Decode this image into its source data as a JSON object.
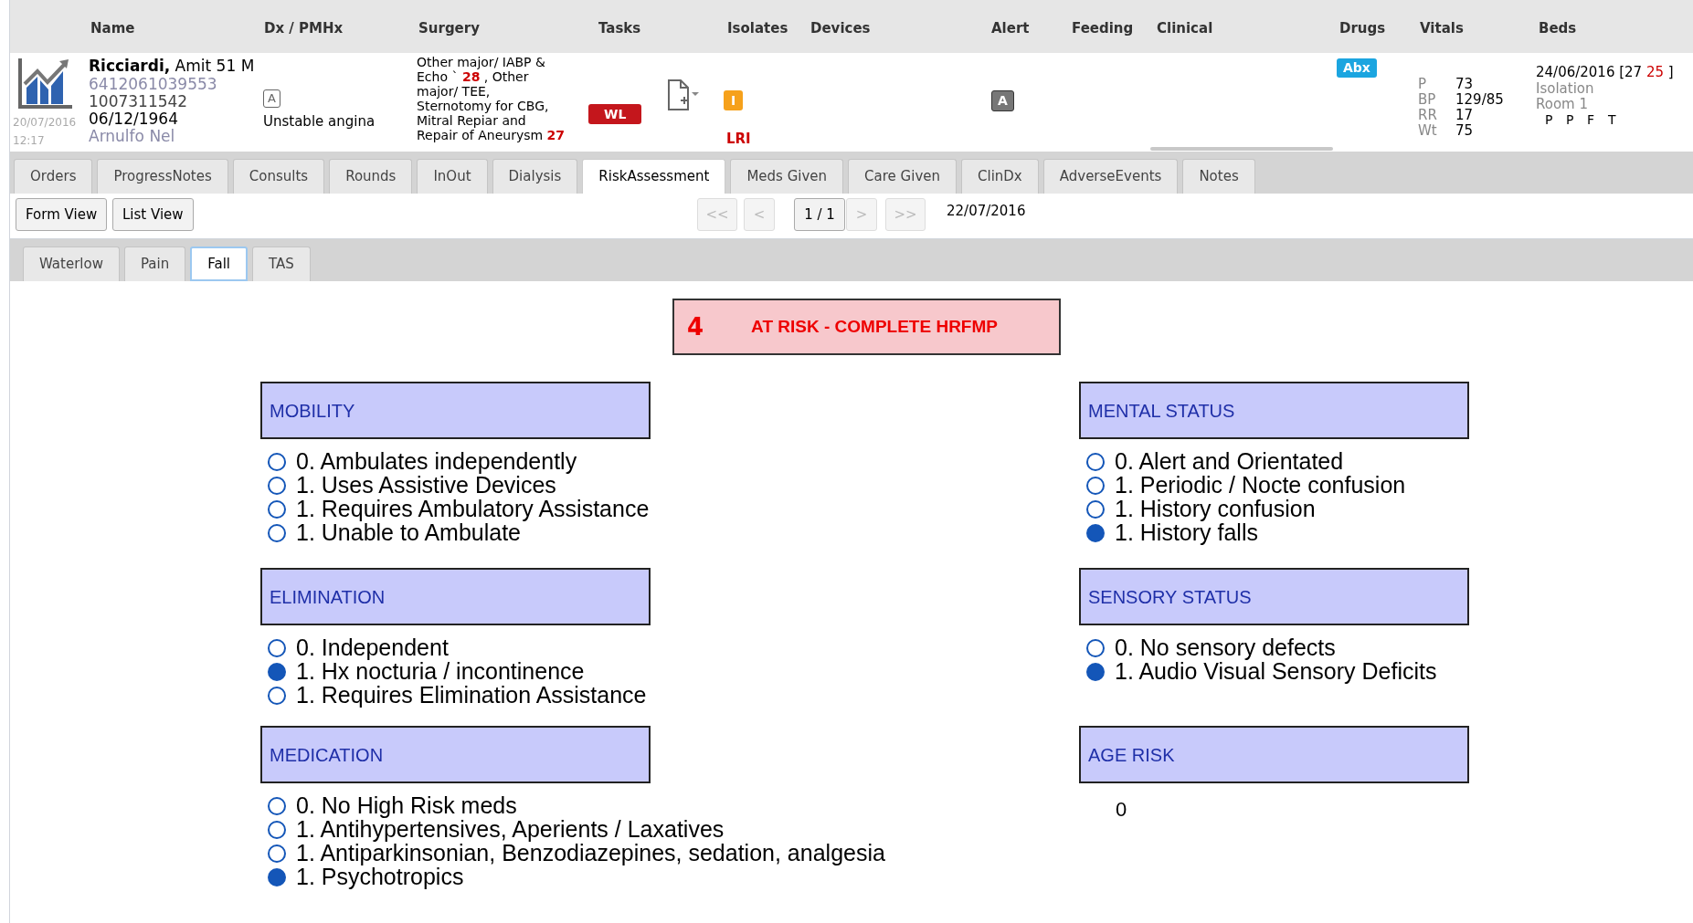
{
  "header": {
    "columns": [
      "Name",
      "Dx / PMHx",
      "Surgery",
      "Tasks",
      "Isolates",
      "Devices",
      "Alert",
      "Feeding",
      "Clinical",
      "Drugs",
      "Vitals",
      "Beds"
    ]
  },
  "patient": {
    "date": "20/07/2016",
    "time": "12:17",
    "name_bold": "Ricciardi,",
    "name_rest": " Amit 51 M",
    "id1": "6412061039553",
    "id2": "1007311542",
    "dob": "06/12/1964",
    "doctor": "Arnulfo Nel",
    "dx_badge": "A",
    "dx": "Unstable angina",
    "surgery": "Other major/ IABP & Echo ` **28** , Other major/ TEE, Sternotomy for CBG, Mitral Repiar and Repair of Aneurysm **27**",
    "task_badge": "WL",
    "isolate_badge": "I",
    "isolate_label": "LRI",
    "alert_badge": "A",
    "drug_badge": "Abx",
    "vitals": [
      {
        "label": "P",
        "value": "73"
      },
      {
        "label": "BP",
        "value": "129/85"
      },
      {
        "label": "RR",
        "value": "17"
      },
      {
        "label": "Wt",
        "value": "75"
      }
    ],
    "bed_date": "24/06/2016 [27",
    "bed_red": "25",
    "bed_close": "]",
    "bed_lines": [
      "Isolation",
      "Room 1"
    ],
    "bed_letters": [
      "P",
      "P",
      "F",
      "T"
    ]
  },
  "tabs": [
    {
      "label": "Orders",
      "selected": false
    },
    {
      "label": "ProgressNotes",
      "selected": false
    },
    {
      "label": "Consults",
      "selected": false
    },
    {
      "label": "Rounds",
      "selected": false
    },
    {
      "label": "InOut",
      "selected": false
    },
    {
      "label": "Dialysis",
      "selected": false
    },
    {
      "label": "RiskAssessment",
      "selected": true
    },
    {
      "label": "Meds Given",
      "selected": false
    },
    {
      "label": "Care Given",
      "selected": false
    },
    {
      "label": "ClinDx",
      "selected": false
    },
    {
      "label": "AdverseEvents",
      "selected": false
    },
    {
      "label": "Notes",
      "selected": false
    }
  ],
  "view_buttons": [
    "Form View",
    "List View"
  ],
  "pager": {
    "first": "<<",
    "prev": "<",
    "page": "1 / 1",
    "next": ">",
    "last": ">>",
    "date": "22/07/2016"
  },
  "subtabs": [
    {
      "label": "Waterlow",
      "selected": false
    },
    {
      "label": "Pain",
      "selected": false
    },
    {
      "label": "Fall",
      "selected": true
    },
    {
      "label": "TAS",
      "selected": false
    }
  ],
  "score": {
    "value": "4",
    "label": "AT RISK - COMPLETE HRFMP"
  },
  "left_sections": [
    {
      "title": "MOBILITY",
      "kind": "options",
      "options": [
        {
          "label": "0. Ambulates independently",
          "selected": false
        },
        {
          "label": "1. Uses Assistive Devices",
          "selected": false
        },
        {
          "label": "1. Requires Ambulatory Assistance",
          "selected": false
        },
        {
          "label": "1. Unable to Ambulate",
          "selected": false
        }
      ]
    },
    {
      "title": "ELIMINATION",
      "kind": "options",
      "options": [
        {
          "label": "0. Independent",
          "selected": false
        },
        {
          "label": "1. Hx nocturia / incontinence",
          "selected": true
        },
        {
          "label": "1. Requires Elimination Assistance",
          "selected": false
        }
      ]
    },
    {
      "title": "MEDICATION",
      "kind": "options",
      "options": [
        {
          "label": "0. No High Risk meds",
          "selected": false
        },
        {
          "label": "1. Antihypertensives, Aperients / Laxatives",
          "selected": false
        },
        {
          "label": "1. Antiparkinsonian, Benzodiazepines, sedation, analgesia",
          "selected": false
        },
        {
          "label": "1. Psychotropics",
          "selected": true
        }
      ]
    }
  ],
  "right_sections": [
    {
      "title": "MENTAL STATUS",
      "kind": "options",
      "options": [
        {
          "label": "0. Alert and Orientated",
          "selected": false
        },
        {
          "label": "1. Periodic / Nocte confusion",
          "selected": false
        },
        {
          "label": "1. History confusion",
          "selected": false
        },
        {
          "label": "1. History falls",
          "selected": true
        }
      ]
    },
    {
      "title": "SENSORY STATUS",
      "kind": "options",
      "options": [
        {
          "label": "0. No sensory defects",
          "selected": false
        },
        {
          "label": "1. Audio Visual Sensory Deficits",
          "selected": true
        }
      ]
    },
    {
      "title": "AGE RISK",
      "kind": "value",
      "value": "0"
    }
  ]
}
